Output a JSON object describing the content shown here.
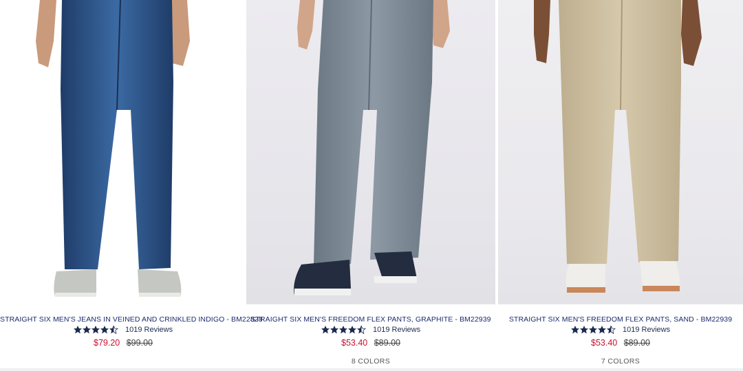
{
  "products": [
    {
      "title": "STRAIGHT SIX MEN'S JEANS IN VEINED AND CRINKLED INDIGO - BM22828",
      "rating": 4.5,
      "reviews": "1019 Reviews",
      "sale_price": "$79.20",
      "original_price": "$99.00",
      "colors": "",
      "pant_color": "#2c4e7e",
      "shoe": "light-sneaker"
    },
    {
      "title": "STRAIGHT SIX MEN'S FREEDOM FLEX PANTS, GRAPHITE - BM22939",
      "rating": 4.5,
      "reviews": "1019 Reviews",
      "sale_price": "$53.40",
      "original_price": "$89.00",
      "colors": "8 COLORS",
      "pant_color": "#7a8794",
      "shoe": "navy-sneaker"
    },
    {
      "title": "STRAIGHT SIX MEN'S FREEDOM FLEX PANTS, SAND - BM22939",
      "rating": 4.5,
      "reviews": "1019 Reviews",
      "sale_price": "$53.40",
      "original_price": "$89.00",
      "colors": "7 COLORS",
      "pant_color": "#cdbf9f",
      "shoe": "white-sneaker"
    }
  ],
  "colors": {
    "sale": "#c8102e",
    "title": "#1b2a6e",
    "star": "#1b2a4e"
  }
}
